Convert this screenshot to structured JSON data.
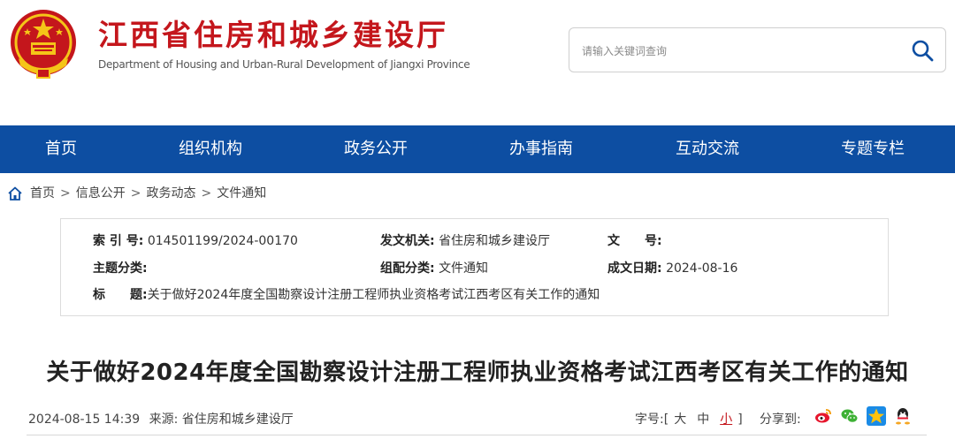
{
  "header": {
    "title": "江西省住房和城乡建设厅",
    "subtitle": "Department of Housing and Urban-Rural Development of Jiangxi Province",
    "search_placeholder": "请输入关键词查询"
  },
  "nav": {
    "items": [
      "首页",
      "组织机构",
      "政务公开",
      "办事指南",
      "互动交流",
      "专题专栏"
    ]
  },
  "breadcrumb": {
    "items": [
      "首页",
      "信息公开",
      "政务动态",
      "文件通知"
    ],
    "separator": ">"
  },
  "meta": {
    "index_no_label": "索 引 号:",
    "index_no": "014501199/2024-00170",
    "issuer_label": "发文机关:",
    "issuer": "省住房和城乡建设厅",
    "doc_no_label": "文　　号:",
    "doc_no": "",
    "topic_label": "主题分类:",
    "topic": "",
    "category_label": "组配分类:",
    "category": "文件通知",
    "date_label": "成文日期:",
    "date": "2024-08-16",
    "title_label": "标　　题:",
    "title": "关于做好2024年度全国勘察设计注册工程师执业资格考试江西考区有关工作的通知"
  },
  "article": {
    "title": "关于做好2024年度全国勘察设计注册工程师执业资格考试江西考区有关工作的通知",
    "datetime": "2024-08-15 14:39",
    "source_label": "来源:",
    "source": "省住房和城乡建设厅",
    "font_size_label": "字号:",
    "font_sizes": [
      "大",
      "中",
      "小"
    ],
    "share_label": "分享到:",
    "share_targets": [
      "weibo-icon",
      "wechat-icon",
      "qzone-icon",
      "qq-icon"
    ]
  },
  "colors": {
    "brand_red": "#c4161c",
    "nav_blue": "#0d4ea2"
  }
}
